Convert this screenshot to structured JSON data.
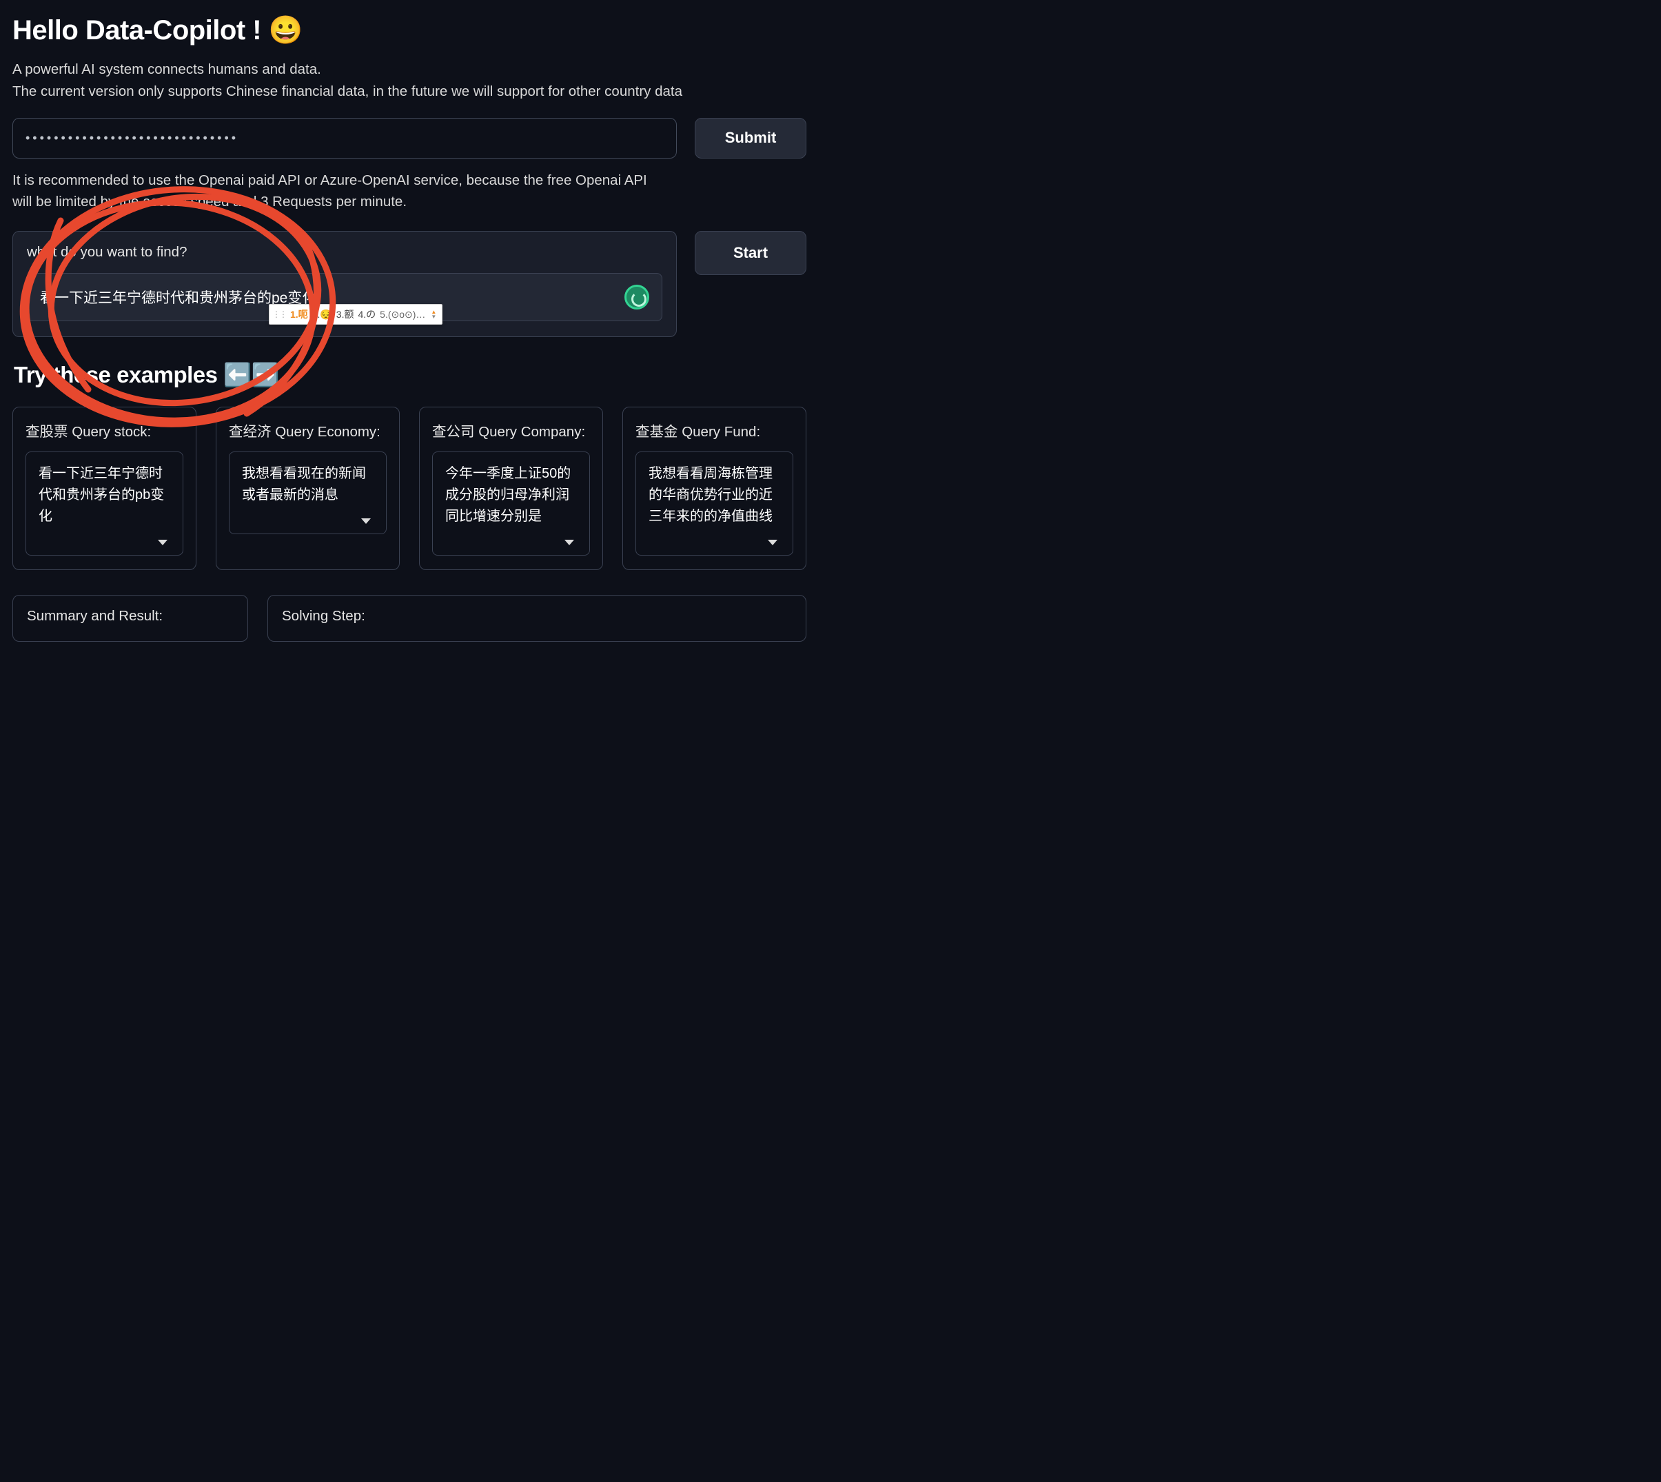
{
  "header": {
    "title": "Hello Data-Copilot ! 😀",
    "subtitle_line1": "A powerful AI system connects humans and data.",
    "subtitle_line2": "The current version only supports Chinese financial data, in the future we will support for other country data"
  },
  "api_key": {
    "masked_value": "••••••••••••••••••••••••••••••",
    "submit_label": "Submit"
  },
  "note": "It is recommended to use the Openai paid API or Azure-OpenAI service, because the free Openai API will be limited by the access speed and 3 Requests per minute.",
  "query": {
    "label": "what do you want to find?",
    "value": "看一下近三年宁德时代和贵州茅台的pe变化",
    "start_label": "Start"
  },
  "ime": {
    "opt1": "1.呃",
    "opt2": "2.😔",
    "opt3": "3.额",
    "opt4": "4.の",
    "opt5": "5.(⊙o⊙)…"
  },
  "examples_heading": "Try these examples ⬅️➡️",
  "examples": [
    {
      "title": "查股票 Query stock:",
      "text": "看一下近三年宁德时代和贵州茅台的pb变化"
    },
    {
      "title": "查经济 Query Economy:",
      "text": "我想看看现在的新闻或者最新的消息"
    },
    {
      "title": "查公司 Query Company:",
      "text": "今年一季度上证50的成分股的归母净利润同比增速分别是"
    },
    {
      "title": "查基金 Query Fund:",
      "text": "我想看看周海栋管理的华商优势行业的近三年来的的净值曲线"
    }
  ],
  "results": {
    "summary_title": "Summary and Result:",
    "step_title": "Solving Step:"
  }
}
